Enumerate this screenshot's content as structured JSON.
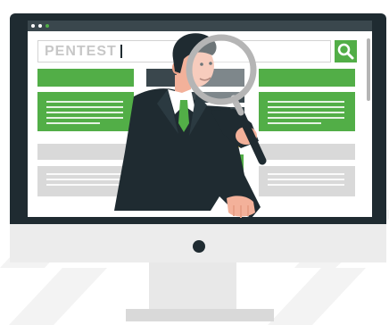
{
  "search": {
    "query": "PENTEST"
  },
  "colors": {
    "accent_green": "#52ae47",
    "dark": "#1f2b31",
    "highlight_yellow": "#f4c62a",
    "placeholder_gray": "#d9d9d9"
  },
  "icons": [
    "search-icon",
    "magnifying-glass-icon",
    "power-indicator-icon"
  ]
}
